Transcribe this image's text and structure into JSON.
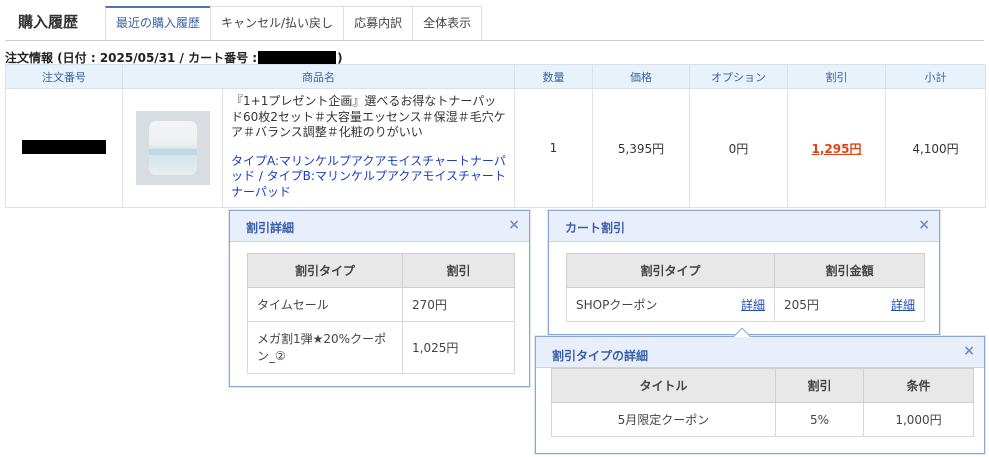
{
  "header": {
    "title": "購入履歴",
    "tabs": [
      {
        "label": "最近の購入履歴",
        "active": true
      },
      {
        "label": "キャンセル/払い戻し",
        "active": false
      },
      {
        "label": "応募内訳",
        "active": false
      },
      {
        "label": "全体表示",
        "active": false
      }
    ]
  },
  "order_info": {
    "prefix": "注文情報 (日付 : 2025/05/31 / カート番号 :",
    "suffix": ")"
  },
  "table": {
    "columns": [
      "注文番号",
      "商品名",
      "数量",
      "価格",
      "オプション",
      "割引",
      "小計"
    ],
    "row": {
      "product_title": "『1+1プレゼント企画』選べるお得なトナーパッド60枚2セット＃大容量エッセンス＃保湿＃毛穴ケア＃バランス調整＃化粧のりがいい",
      "product_option": "タイプA:マリンケルプアクアモイスチャートナーパッド / タイプB:マリンケルプアクアモイスチャートナーパッド",
      "quantity": "1",
      "price": "5,395円",
      "option": "0円",
      "discount": "1,295円",
      "subtotal": "4,100円"
    }
  },
  "discount_popup": {
    "title": "割引詳細",
    "close": "×",
    "headers": [
      "割引タイプ",
      "割引"
    ],
    "rows": [
      {
        "type": "タイムセール",
        "amount": "270円"
      },
      {
        "type": "メガ割1弾★20%クーポン_②",
        "amount": "1,025円"
      }
    ]
  },
  "cart_popup": {
    "title": "カート割引",
    "close": "×",
    "headers": [
      "割引タイプ",
      "割引金額"
    ],
    "row": {
      "type": "SHOPクーポン",
      "link": "詳細",
      "amount": "205円",
      "amount_link": "詳細"
    }
  },
  "type_popup": {
    "title": "割引タイプの詳細",
    "close": "×",
    "headers": [
      "タイトル",
      "割引",
      "条件"
    ],
    "row": {
      "title": "5月限定クーポン",
      "discount": "5%",
      "condition": "1,000円"
    }
  },
  "colors": {
    "accent": "#3a64a6",
    "discount_link": "#e0431a",
    "option_text": "#1a3cc4",
    "popup_border": "#8aa6d8"
  }
}
